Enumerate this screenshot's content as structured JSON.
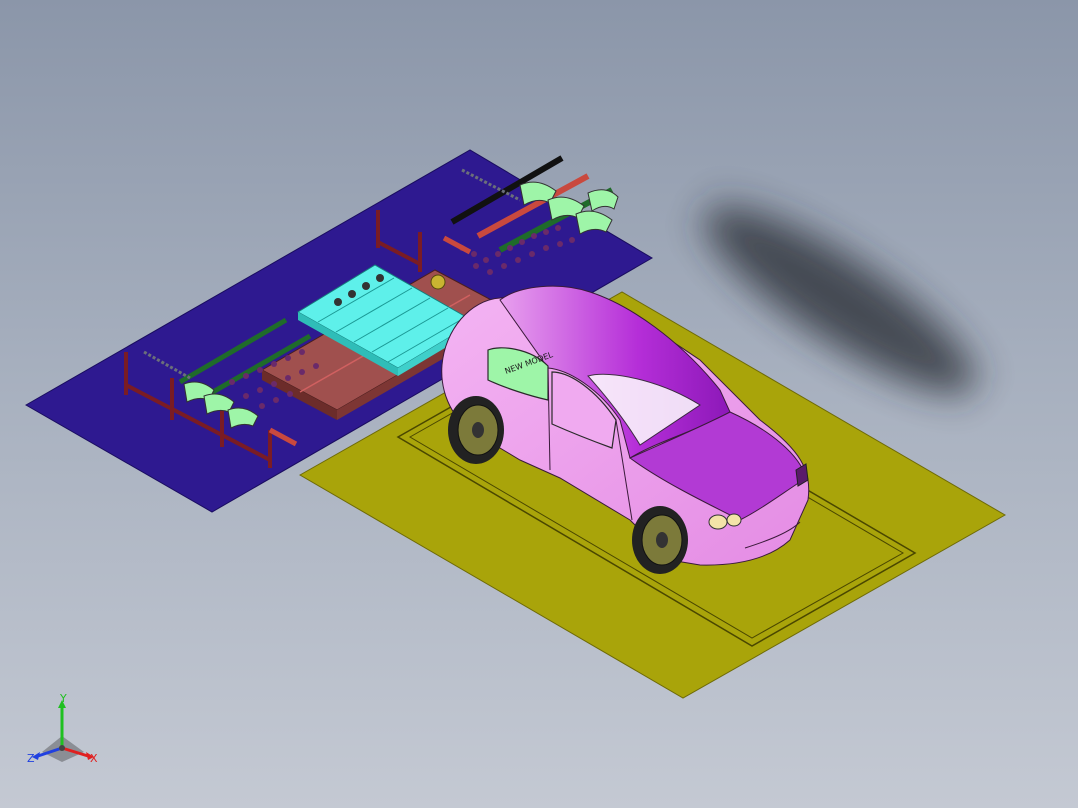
{
  "scene": {
    "description_free": true,
    "colors": {
      "background_top": "#8b96a9",
      "background_bottom": "#c4c9d3",
      "platform": "#2e1990",
      "floor_plate": "#a9a40a",
      "car_body": "#ee9ef0",
      "car_roof": "#c23ee6",
      "conveyor": "#5ef0ea",
      "carriage": "#a0504e",
      "rails_green": "#9ef5a8",
      "rails_red": "#c9493e",
      "posts": "#7a1c24",
      "shadow": "#2b2f38"
    },
    "car_badge_text": "NEW MODEL"
  },
  "triad": {
    "y_label": "Y",
    "x_label": "X",
    "z_label": "Z",
    "colors": {
      "x": "#e02020",
      "y": "#1fc020",
      "z": "#2040e0"
    }
  }
}
